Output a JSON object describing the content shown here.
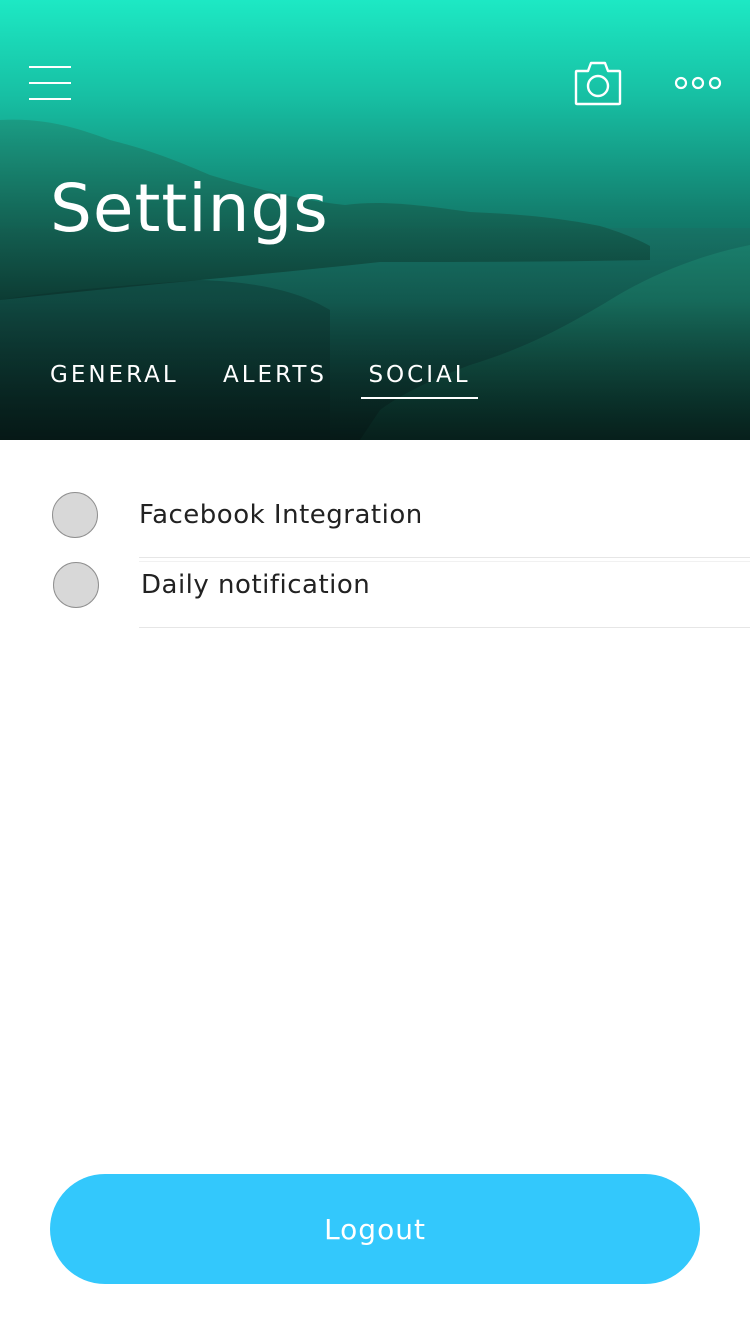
{
  "colors": {
    "header_top": "#1de9c4",
    "header_bottom": "#0b2824",
    "accent": "#33c8fc",
    "toggle_off": "#d8d8d8",
    "text": "#222222"
  },
  "header": {
    "title": "Settings",
    "icons": {
      "menu": "menu-icon",
      "camera": "camera-icon",
      "more": "more-icon"
    },
    "tabs": [
      {
        "label": "GENERAL",
        "active": false
      },
      {
        "label": "ALERTS",
        "active": false
      },
      {
        "label": "SOCIAL",
        "active": true
      }
    ]
  },
  "settings": {
    "items": [
      {
        "label": "Facebook Integration",
        "enabled": false
      },
      {
        "label": "Daily notification",
        "enabled": false
      }
    ]
  },
  "footer": {
    "logout_label": "Logout"
  }
}
